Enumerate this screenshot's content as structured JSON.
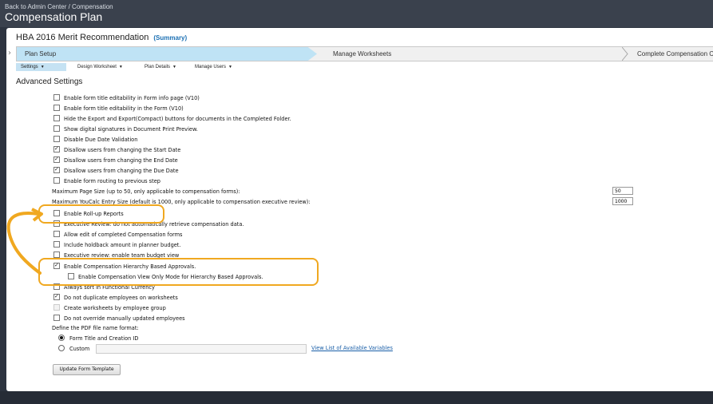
{
  "header": {
    "breadcrumb": "Back to Admin Center / Compensation",
    "title": "Compensation Plan"
  },
  "plan": {
    "name": "HBA 2016 Merit Recommendation",
    "summary_link": "(Summary)"
  },
  "steps": [
    {
      "label": "Plan Setup",
      "active": true
    },
    {
      "label": "Manage Worksheets",
      "active": false
    },
    {
      "label": "Complete Compensation Cycle",
      "active": false
    }
  ],
  "subtabs": [
    {
      "label": "Settings",
      "active": true
    },
    {
      "label": "Design Worksheet",
      "active": false
    },
    {
      "label": "Plan Details",
      "active": false
    },
    {
      "label": "Manage Users",
      "active": false
    }
  ],
  "section_title": "Advanced Settings",
  "settings_group1": [
    {
      "label": "Enable form title editability in Form info page (V10)",
      "checked": false
    },
    {
      "label": "Enable form title editability in the Form (V10)",
      "checked": false
    },
    {
      "label": "Hide the Export and Export(Compact) buttons for documents in the Completed Folder.",
      "checked": false
    },
    {
      "label": "Show digital signatures in Document Print Preview.",
      "checked": false
    },
    {
      "label": "Disable Due Date Validation",
      "checked": false
    },
    {
      "label": "Disallow users from changing the Start Date",
      "checked": true
    },
    {
      "label": "Disallow users from changing the End Date",
      "checked": true
    },
    {
      "label": "Disallow users from changing the Due Date",
      "checked": true
    },
    {
      "label": "Enable form routing to previous step",
      "checked": false
    }
  ],
  "max_page_size": {
    "label": "Maximum Page Size (up to 50, only applicable to compensation forms):",
    "value": "50"
  },
  "max_youcalc": {
    "label": "Maximum YouCalc Entry Size (default is 1000, only applicable to compensation executive review):",
    "value": "1000"
  },
  "settings_group2": [
    {
      "label": "Enable Roll-up Reports",
      "checked": false
    },
    {
      "label": "Executive Review: do not automatically retrieve compensation data.",
      "checked": false
    },
    {
      "label": "Allow edit of completed Compensation forms",
      "checked": false
    },
    {
      "label": "Include holdback amount in planner budget.",
      "checked": false
    },
    {
      "label": "Executive review: enable team budget view",
      "checked": false
    },
    {
      "label": "Enable Compensation Hierarchy Based Approvals.",
      "checked": true
    },
    {
      "label": "Enable Compensation View Only Mode for Hierarchy Based Approvals.",
      "checked": false
    },
    {
      "label": "Always sort in Functional Currency",
      "checked": false
    },
    {
      "label": "Do not duplicate employees on worksheets",
      "checked": true
    },
    {
      "label": "Create worksheets by employee group",
      "checked": false,
      "disabled": true
    },
    {
      "label": "Do not override manually updated employees",
      "checked": false
    }
  ],
  "pdf": {
    "label": "Define the PDF file name format:",
    "option1": "Form Title and Creation ID",
    "option2": "Custom",
    "selected": "option1",
    "custom_value": "",
    "link": "View List of Available Variables"
  },
  "update_button": "Update Form Template",
  "colors": {
    "active_step": "#bfe3f5",
    "highlight": "#f0a820",
    "link": "#1a5fa8",
    "header_bg": "#3a414d"
  }
}
